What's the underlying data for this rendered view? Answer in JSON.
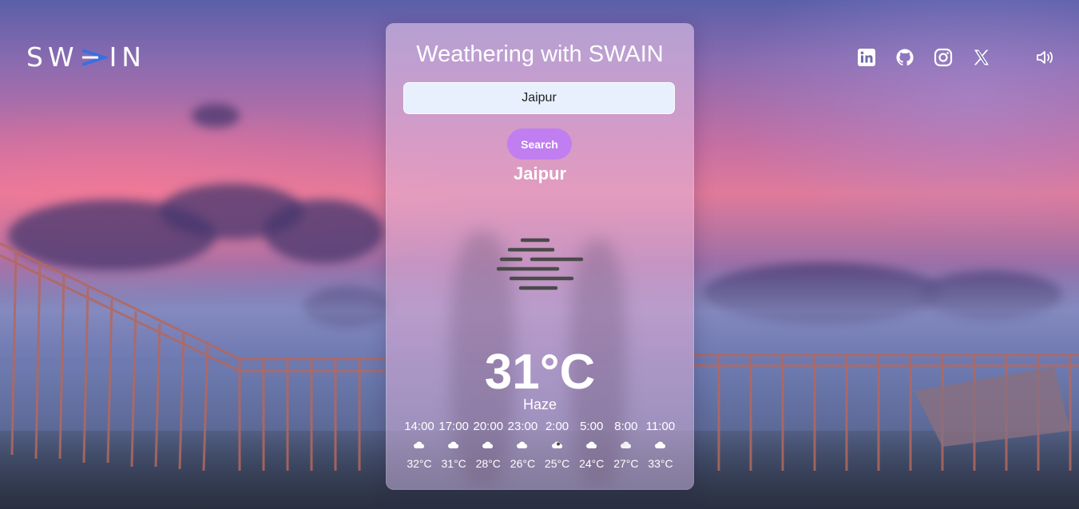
{
  "brand": {
    "logo_left": "SW",
    "logo_right": "IN"
  },
  "socials": [
    {
      "name": "linkedin-icon"
    },
    {
      "name": "github-icon"
    },
    {
      "name": "instagram-icon"
    },
    {
      "name": "x-twitter-icon"
    }
  ],
  "sound": {
    "icon": "speaker-volume-icon"
  },
  "card": {
    "title": "Weathering with SWAIN",
    "search_value": "Jaipur",
    "search_button": "Search",
    "city": "Jaipur",
    "weather_icon": "haze-mist-icon",
    "temperature": "31°C",
    "condition": "Haze"
  },
  "forecast": [
    {
      "time": "14:00",
      "icon": "cloud-icon",
      "temp": "32°C"
    },
    {
      "time": "17:00",
      "icon": "cloud-icon",
      "temp": "31°C"
    },
    {
      "time": "20:00",
      "icon": "cloud-icon",
      "temp": "28°C"
    },
    {
      "time": "23:00",
      "icon": "cloud-icon",
      "temp": "26°C"
    },
    {
      "time": "2:00",
      "icon": "cloud-moon-icon",
      "temp": "25°C"
    },
    {
      "time": "5:00",
      "icon": "cloud-icon",
      "temp": "24°C"
    },
    {
      "time": "8:00",
      "icon": "cloud-sun-icon",
      "temp": "27°C"
    },
    {
      "time": "11:00",
      "icon": "cloud-icon",
      "temp": "33°C"
    }
  ],
  "colors": {
    "accent": "#c07ef0",
    "input_bg": "#e8f0fe",
    "text": "#ffffff",
    "haze_icon": "#4a4a4a"
  }
}
